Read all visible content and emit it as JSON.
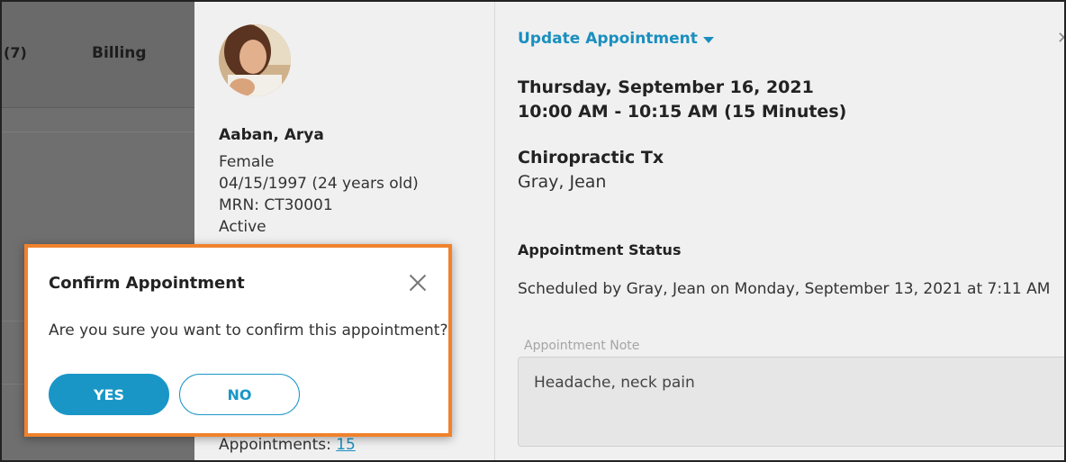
{
  "background": {
    "count_label": "(7)",
    "billing_label": "Billing"
  },
  "patient": {
    "name": "Aaban, Arya",
    "gender": "Female",
    "dob": "04/15/1997 (24 years old)",
    "mrn": "MRN: CT30001",
    "status": "Active",
    "appointments_label": "Appointments: ",
    "appointments_count": "15"
  },
  "appointment": {
    "update_label": "Update Appointment",
    "date": "Thursday, September 16, 2021",
    "time": "10:00 AM - 10:15 AM (15 Minutes)",
    "type": "Chiropractic Tx",
    "provider": "Gray, Jean",
    "status_label": "Appointment Status",
    "status_text": "Scheduled by Gray, Jean on Monday, September 13, 2021 at 7:11 AM",
    "note_label": "Appointment Note",
    "note_value": "Headache, neck pain"
  },
  "modal": {
    "title": "Confirm Appointment",
    "message": "Are you sure you want to confirm this appointment?",
    "yes_label": "YES",
    "no_label": "NO"
  },
  "colors": {
    "accent": "#1a96c6",
    "modal_highlight": "#f0822c"
  }
}
